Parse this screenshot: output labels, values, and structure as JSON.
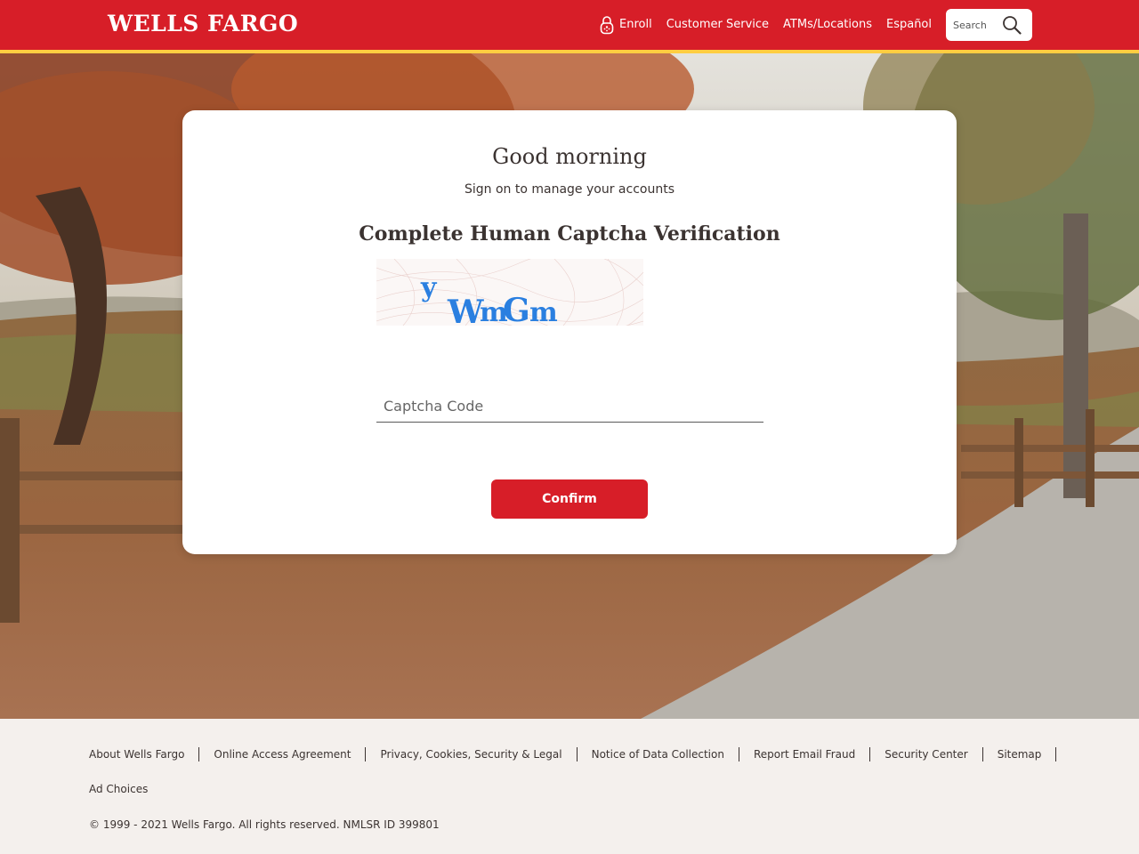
{
  "header": {
    "logo": "WELLS FARGO",
    "nav": {
      "enroll": "Enroll",
      "customer_service": "Customer Service",
      "atms_locations": "ATMs/Locations",
      "espanol": "Español"
    },
    "search": {
      "placeholder": "Search"
    }
  },
  "card": {
    "greeting": "Good morning",
    "subtitle": "Sign on to manage your accounts",
    "captcha_title": "Complete Human Captcha Verification",
    "captcha_image_text": "y WmGm",
    "captcha_input": {
      "placeholder": "Captcha Code",
      "value": ""
    },
    "confirm_label": "Confirm"
  },
  "footer": {
    "links": [
      "About Wells Fargo",
      "Online Access Agreement",
      "Privacy, Cookies, Security & Legal",
      "Notice of Data Collection",
      "Report Email Fraud",
      "Security Center",
      "Sitemap"
    ],
    "ad_choices": "Ad Choices",
    "copyright": "© 1999 - 2021 Wells Fargo. All rights reserved. NMLSR ID 399801"
  },
  "colors": {
    "brand_red": "#d71e28",
    "brand_gold": "#ffcd41",
    "text_dark": "#3b3331",
    "captcha_blue": "#2a7fe0"
  }
}
